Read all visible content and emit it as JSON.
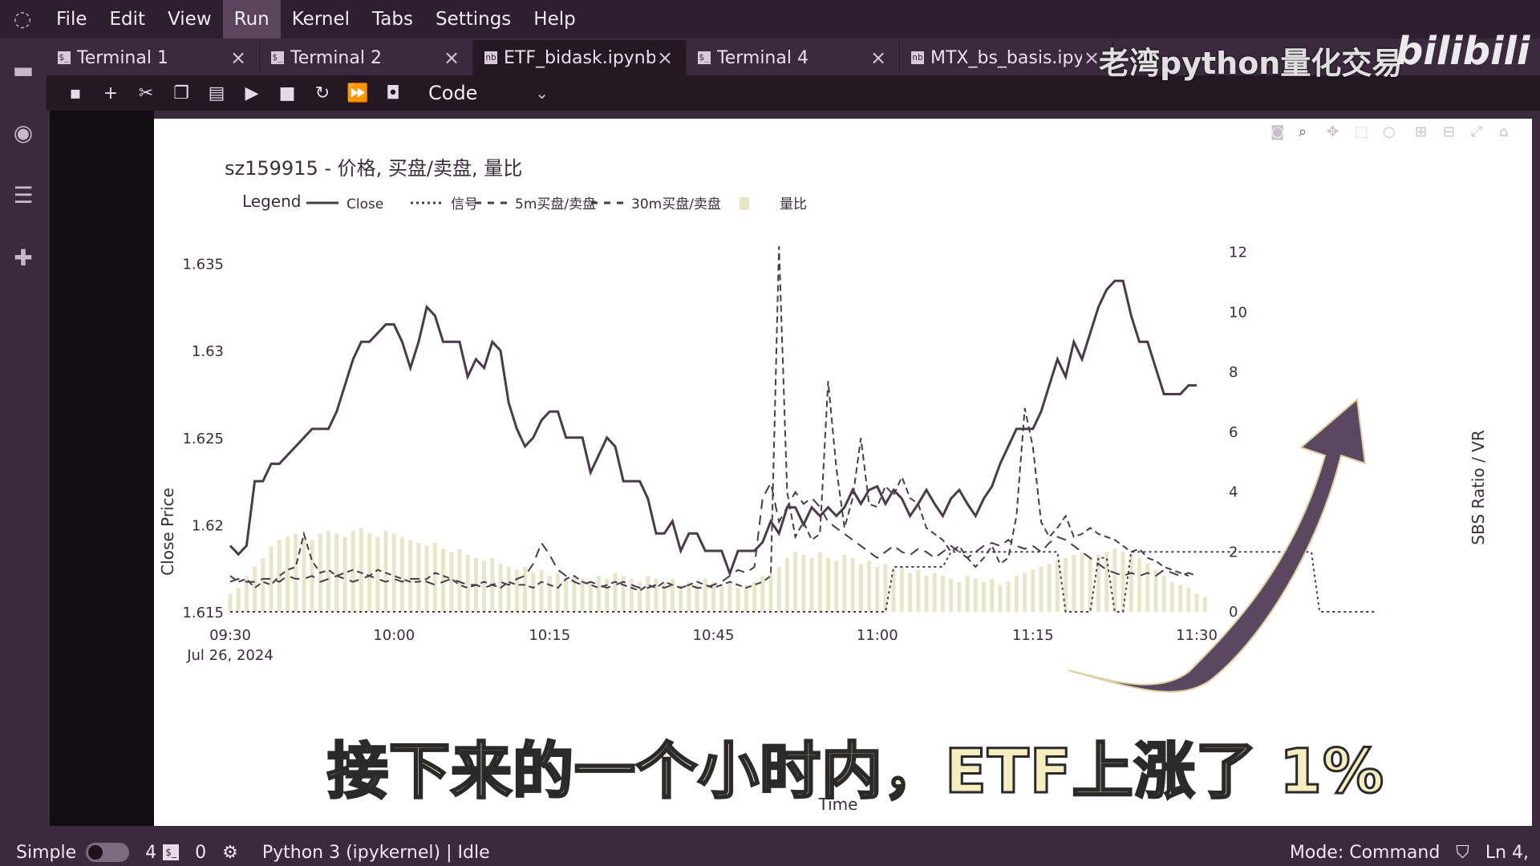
{
  "menu": {
    "logo_icon": "jupyter-logo-icon",
    "items": [
      "File",
      "Edit",
      "View",
      "Run",
      "Kernel",
      "Tabs",
      "Settings",
      "Help"
    ],
    "active": "Run"
  },
  "sidebar_icons": [
    "folder-icon",
    "running-icon",
    "toc-icon",
    "extension-icon"
  ],
  "tabs": [
    {
      "label": "Terminal 1",
      "icon": "$_",
      "active": false
    },
    {
      "label": "Terminal 2",
      "icon": "$_",
      "active": false
    },
    {
      "label": "ETF_bidask.ipynb",
      "icon": "nb",
      "active": true
    },
    {
      "label": "Terminal 4",
      "icon": "$_",
      "active": false
    },
    {
      "label": "MTX_bs_basis.ipyn",
      "icon": "nb",
      "active": false
    }
  ],
  "toolbar": {
    "buttons": [
      "save-icon",
      "add-cell-icon",
      "cut-icon",
      "copy-icon",
      "paste-icon",
      "run-icon",
      "stop-icon",
      "restart-icon",
      "run-all-icon",
      "palette-icon"
    ],
    "cell_type": "Code"
  },
  "watermark": "老湾python量化交易",
  "watermark_brand": "bilibili",
  "subtitle": "接下来的一个小时内，ETF上涨了 1%",
  "statusbar": {
    "mode_label": "Simple",
    "terminals_count": "4",
    "kernels_count": "0",
    "kernel": "Python 3 (ipykernel) | Idle",
    "mode": "Mode: Command",
    "cursor": "Ln 4,"
  },
  "chart_data": {
    "type": "line",
    "title": "sz159915 - 价格, 买盘/卖盘, 量比",
    "legend_title": "Legend",
    "legend_position": "top",
    "xlabel": "Time",
    "ylabel": "Close Price",
    "y2label": "SBS Ratio / VR",
    "x_ticks": [
      "09:30",
      "10:00",
      "10:15",
      "10:45",
      "11:00",
      "11:15",
      "11:30"
    ],
    "x_date_label": "Jul 26, 2024",
    "ylim": [
      1.615,
      1.6365
    ],
    "y_ticks": [
      1.615,
      1.62,
      1.625,
      1.63,
      1.635
    ],
    "y_tick_labels": [
      "1.615",
      "1.62",
      "1.625",
      "1.63",
      "1.635"
    ],
    "y2lim": [
      0,
      12.5
    ],
    "y2_ticks": [
      0,
      2,
      4,
      6,
      8,
      10,
      12
    ],
    "grid": false,
    "series": [
      {
        "name": "Close",
        "style": "solid",
        "axis": "y",
        "values": [
          1.6188,
          1.6183,
          1.6188,
          1.6225,
          1.6225,
          1.6235,
          1.6235,
          1.624,
          1.6245,
          1.625,
          1.6255,
          1.6255,
          1.6255,
          1.6265,
          1.628,
          1.6295,
          1.6305,
          1.6305,
          1.631,
          1.6315,
          1.6315,
          1.6305,
          1.629,
          1.6305,
          1.6325,
          1.632,
          1.6305,
          1.6305,
          1.6305,
          1.6285,
          1.6295,
          1.629,
          1.6305,
          1.63,
          1.627,
          1.6255,
          1.6245,
          1.625,
          1.626,
          1.6265,
          1.6265,
          1.625,
          1.625,
          1.625,
          1.623,
          1.624,
          1.625,
          1.6245,
          1.6225,
          1.6225,
          1.6225,
          1.6215,
          1.6195,
          1.6195,
          1.6202,
          1.6185,
          1.6195,
          1.6195,
          1.6185,
          1.6185,
          1.6185,
          1.6172,
          1.6185,
          1.6185,
          1.6185,
          1.619,
          1.6202,
          1.6195,
          1.621,
          1.621,
          1.62,
          1.621,
          1.6205,
          1.621,
          1.6205,
          1.621,
          1.622,
          1.6212,
          1.622,
          1.6222,
          1.6212,
          1.622,
          1.6215,
          1.6205,
          1.6212,
          1.622,
          1.6212,
          1.6205,
          1.6215,
          1.622,
          1.6212,
          1.6205,
          1.6215,
          1.6222,
          1.6235,
          1.6245,
          1.6255,
          1.6255,
          1.6255,
          1.6265,
          1.628,
          1.6295,
          1.6285,
          1.6305,
          1.6295,
          1.631,
          1.6325,
          1.6335,
          1.634,
          1.634,
          1.632,
          1.6305,
          1.6305,
          1.629,
          1.6275,
          1.6275,
          1.6275,
          1.628,
          1.628
        ]
      },
      {
        "name": "信号",
        "style": "dotted",
        "axis": "y2",
        "values": [
          0,
          0,
          0,
          0,
          0,
          0,
          0,
          0,
          0,
          0,
          0,
          0,
          0,
          0,
          0,
          0,
          0,
          0,
          0,
          0,
          0,
          0,
          0,
          0,
          0,
          0,
          0,
          0,
          0,
          0,
          0,
          0,
          0,
          0,
          0,
          0,
          0,
          0,
          0,
          0,
          0,
          0,
          0,
          0,
          0,
          0,
          0,
          0,
          0,
          0,
          0,
          0,
          0,
          0,
          0,
          0,
          0,
          0,
          0,
          0,
          0,
          0,
          0,
          0,
          0,
          0,
          0,
          0,
          0,
          0,
          0,
          0,
          0,
          0,
          0,
          0,
          0,
          0,
          0,
          0,
          0,
          1.5,
          1.5,
          1.5,
          1.5,
          1.5,
          1.5,
          1.5,
          2,
          2,
          2,
          2,
          2,
          2,
          2,
          2,
          2,
          2,
          2,
          2,
          2,
          2,
          0,
          0,
          0,
          0,
          1.8,
          1.8,
          0,
          0,
          2,
          2,
          2,
          2,
          2,
          2,
          2,
          2,
          2,
          2,
          2,
          2,
          2,
          2,
          2,
          2,
          2,
          2,
          2,
          2,
          2,
          2,
          2,
          0,
          0,
          0,
          0,
          0,
          0,
          0,
          0
        ]
      },
      {
        "name": "5m买盘/卖盘",
        "style": "dashed",
        "axis": "y2",
        "values": [
          1.2,
          1.0,
          1.1,
          0.8,
          1.0,
          0.9,
          1.2,
          1.4,
          1.5,
          2.6,
          1.7,
          1.3,
          1.4,
          1.2,
          1.3,
          1.4,
          1.3,
          1.2,
          1.4,
          1.3,
          1.2,
          1.1,
          1.0,
          1.0,
          1.1,
          1.3,
          1.2,
          1.1,
          0.9,
          0.8,
          0.9,
          1.0,
          0.9,
          0.8,
          1.0,
          0.9,
          0.9,
          0.8,
          1.0,
          0.9,
          0.8,
          1.1,
          1.2,
          1.0,
          0.9,
          0.8,
          0.9,
          1.0,
          0.9,
          0.8,
          0.7,
          0.9,
          0.8,
          1.0,
          0.9,
          0.8,
          0.9,
          1.0,
          0.9,
          0.8,
          0.9,
          1.0,
          0.9,
          0.8,
          0.9,
          1.0,
          1.2,
          12.2,
          4.0,
          2.5,
          3.0,
          2.4,
          2.6,
          7.7,
          4.8,
          2.8,
          3.8,
          5.8,
          3.6,
          3.5,
          4.2,
          3.9,
          4.5,
          3.8,
          3.6,
          2.8,
          2.6,
          2.4,
          2.0,
          2.2,
          1.8,
          1.5,
          1.8,
          2.2,
          1.6,
          1.8,
          3.2,
          6.8,
          5.5,
          3.0,
          2.5,
          2.8,
          3.2,
          2.5,
          2.6,
          2.8,
          2.6,
          2.5,
          2.4,
          2.2,
          2.0,
          2.1,
          1.8,
          1.7,
          1.5,
          1.4,
          1.3,
          1.2
        ]
      },
      {
        "name": "30m买盘/卖盘",
        "style": "dashed",
        "axis": "y2",
        "values": [
          1.0,
          1.1,
          1.0,
          1.0,
          1.1,
          1.1,
          1.0,
          1.2,
          1.1,
          1.1,
          1.2,
          1.0,
          1.1,
          1.2,
          1.1,
          1.0,
          1.1,
          1.2,
          1.1,
          1.0,
          1.1,
          1.0,
          1.1,
          1.1,
          1.0,
          0.9,
          1.0,
          1.1,
          1.0,
          0.9,
          0.9,
          0.8,
          0.9,
          1.0,
          0.9,
          1.1,
          1.2,
          1.6,
          2.3,
          1.9,
          1.4,
          1.2,
          1.0,
          0.9,
          1.0,
          0.9,
          0.8,
          0.9,
          1.0,
          0.9,
          0.8,
          0.8,
          0.9,
          0.8,
          0.9,
          0.8,
          0.9,
          0.8,
          0.8,
          0.9,
          1.0,
          1.2,
          1.4,
          1.3,
          1.5,
          3.8,
          4.3,
          3.0,
          3.5,
          4.0,
          3.6,
          3.8,
          3.5,
          3.0,
          2.8,
          2.6,
          2.4,
          2.2,
          2.0,
          1.8,
          2.0,
          2.2,
          2.0,
          1.9,
          2.1,
          2.0,
          1.8,
          2.0,
          2.2,
          2.0,
          1.8,
          2.0,
          2.2,
          2.3,
          2.2,
          2.4,
          2.2,
          2.1,
          2.2,
          2.0,
          2.3,
          2.5,
          2.4,
          2.2,
          2.0,
          1.8,
          1.6,
          1.4,
          1.3,
          1.2,
          1.3,
          1.2,
          1.3,
          1.2,
          1.4,
          1.3,
          1.2,
          1.3,
          1.2
        ]
      },
      {
        "name": "量比",
        "style": "bar",
        "axis": "y2",
        "values": [
          0.6,
          0.8,
          1.2,
          1.5,
          1.8,
          2.2,
          2.4,
          2.5,
          2.6,
          2.5,
          2.4,
          2.6,
          2.7,
          2.6,
          2.5,
          2.7,
          2.8,
          2.6,
          2.5,
          2.7,
          2.6,
          2.5,
          2.4,
          2.3,
          2.2,
          2.3,
          2.1,
          2.0,
          2.1,
          1.9,
          1.8,
          1.7,
          1.8,
          1.6,
          1.5,
          1.4,
          1.5,
          1.3,
          1.4,
          1.2,
          1.3,
          1.1,
          1.2,
          1.1,
          1.0,
          1.2,
          1.1,
          1.3,
          1.2,
          1.1,
          1.0,
          1.2,
          1.1,
          1.0,
          1.1,
          0.9,
          1.0,
          0.9,
          1.1,
          1.0,
          0.9,
          1.0,
          0.8,
          0.9,
          1.0,
          1.2,
          1.3,
          1.5,
          1.8,
          2.0,
          1.9,
          1.8,
          2.0,
          1.8,
          1.7,
          1.9,
          1.8,
          1.6,
          1.7,
          1.5,
          1.6,
          1.4,
          1.5,
          1.3,
          1.4,
          1.2,
          1.3,
          1.2,
          1.1,
          1.0,
          1.2,
          1.1,
          1.0,
          1.1,
          0.9,
          1.0,
          1.2,
          1.3,
          1.4,
          1.5,
          1.6,
          1.7,
          1.8,
          1.9,
          2.0,
          1.8,
          1.9,
          2.0,
          2.1,
          2.0,
          1.9,
          1.8,
          1.6,
          1.4,
          1.2,
          1.0,
          0.9,
          0.8,
          0.6,
          0.5
        ]
      }
    ],
    "annotation_arrow": "up-arrow"
  }
}
